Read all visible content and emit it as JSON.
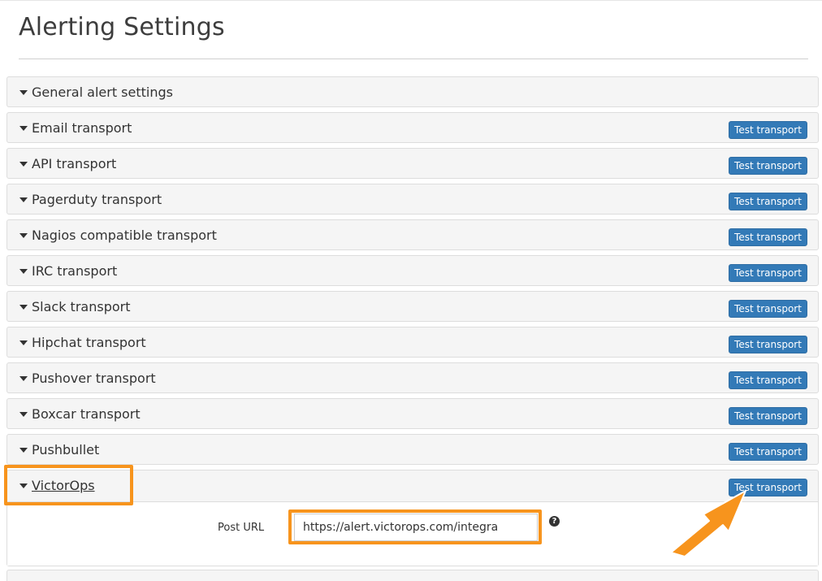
{
  "page": {
    "title": "Alerting Settings"
  },
  "panels": [
    {
      "label": "General alert settings",
      "button": ""
    },
    {
      "label": "Email transport",
      "button": "Test transport"
    },
    {
      "label": "API transport",
      "button": "Test transport"
    },
    {
      "label": "Pagerduty transport",
      "button": "Test transport"
    },
    {
      "label": "Nagios compatible transport",
      "button": "Test transport"
    },
    {
      "label": "IRC transport",
      "button": "Test transport"
    },
    {
      "label": "Slack transport",
      "button": "Test transport"
    },
    {
      "label": "Hipchat transport",
      "button": "Test transport"
    },
    {
      "label": "Pushover transport",
      "button": "Test transport"
    },
    {
      "label": "Boxcar transport",
      "button": "Test transport"
    },
    {
      "label": "Pushbullet",
      "button": "Test transport"
    }
  ],
  "victorops": {
    "label": "VictorOps",
    "button": "Test transport",
    "post_url_label": "Post URL",
    "post_url_value": "https://alert.victorops.com/integra",
    "help_icon": "question-circle-icon",
    "help_glyph": "?"
  },
  "colors": {
    "highlight": "#f7941d",
    "button": "#337ab7",
    "panel_heading": "#f5f5f5"
  }
}
